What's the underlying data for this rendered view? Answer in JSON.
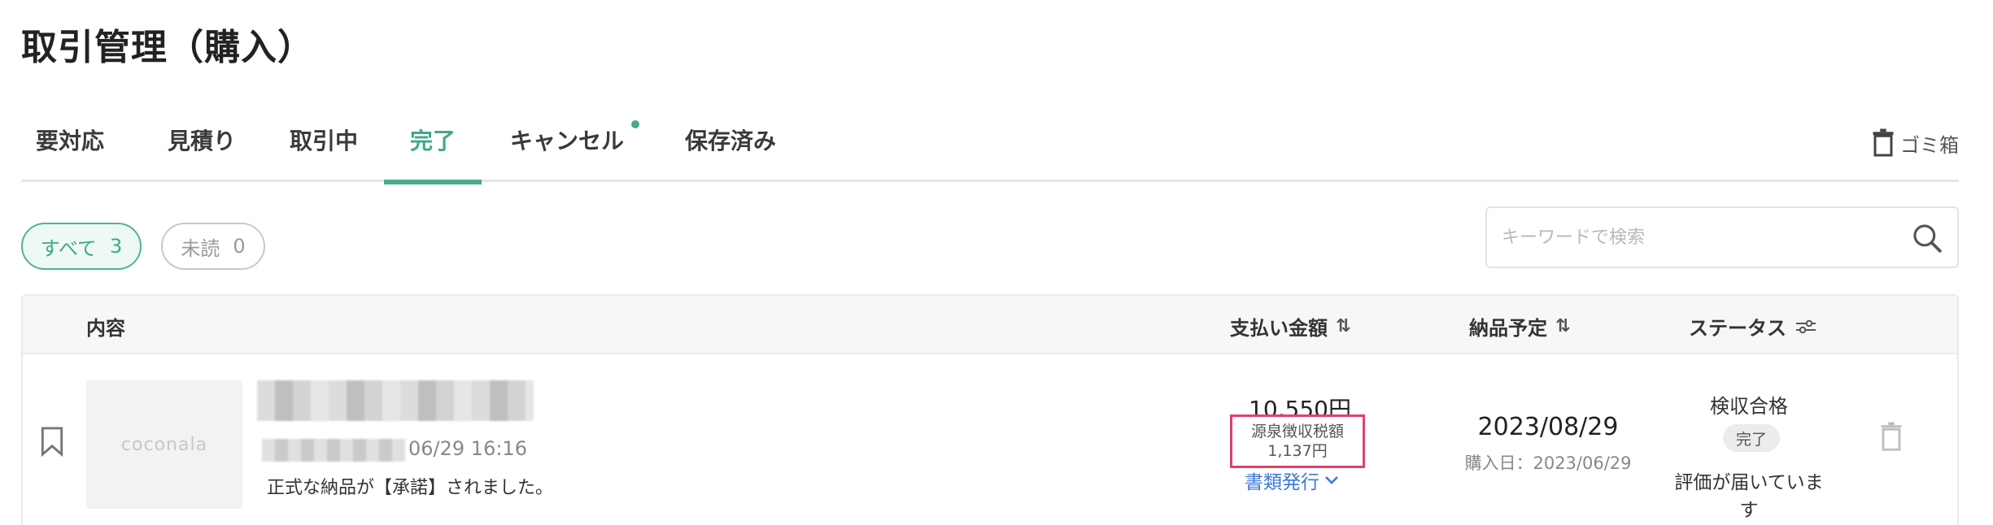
{
  "page": {
    "title": "取引管理（購入）"
  },
  "tabs": [
    {
      "label": "要対応",
      "active": false
    },
    {
      "label": "見積り",
      "active": false
    },
    {
      "label": "取引中",
      "active": false
    },
    {
      "label": "完了",
      "active": true
    },
    {
      "label": "キャンセル",
      "active": false,
      "has_dot": true
    },
    {
      "label": "保存済み",
      "active": false
    }
  ],
  "trash_link": {
    "label": "ゴミ箱",
    "icon": "trash-icon"
  },
  "filters": {
    "all": {
      "label": "すべて",
      "count": "3",
      "active": true
    },
    "unread": {
      "label": "未読",
      "count": "0",
      "active": false
    }
  },
  "search": {
    "placeholder": "キーワードで検索",
    "value": "",
    "icon": "search-icon"
  },
  "table": {
    "headers": {
      "content": "内容",
      "amount": "支払い金額",
      "delivery": "納品予定",
      "status": "ステータス"
    },
    "rows": [
      {
        "thumbnail_text": "coconala",
        "date": "06/29 16:16",
        "message": "正式な納品が【承諾】されました。",
        "amount": "10,550円",
        "tax_label": "源泉徴収税額",
        "tax_amount": "1,137円",
        "doc_issue": "書類発行",
        "delivery_date": "2023/08/29",
        "purchase_date": "購入日：2023/06/29",
        "status_text": "検収合格",
        "status_badge": "完了",
        "review_text": "評価が届いています"
      }
    ]
  },
  "colors": {
    "accent_green": "#4aaa8c",
    "highlight_red": "#e0416f",
    "link_blue": "#3d78d8"
  }
}
